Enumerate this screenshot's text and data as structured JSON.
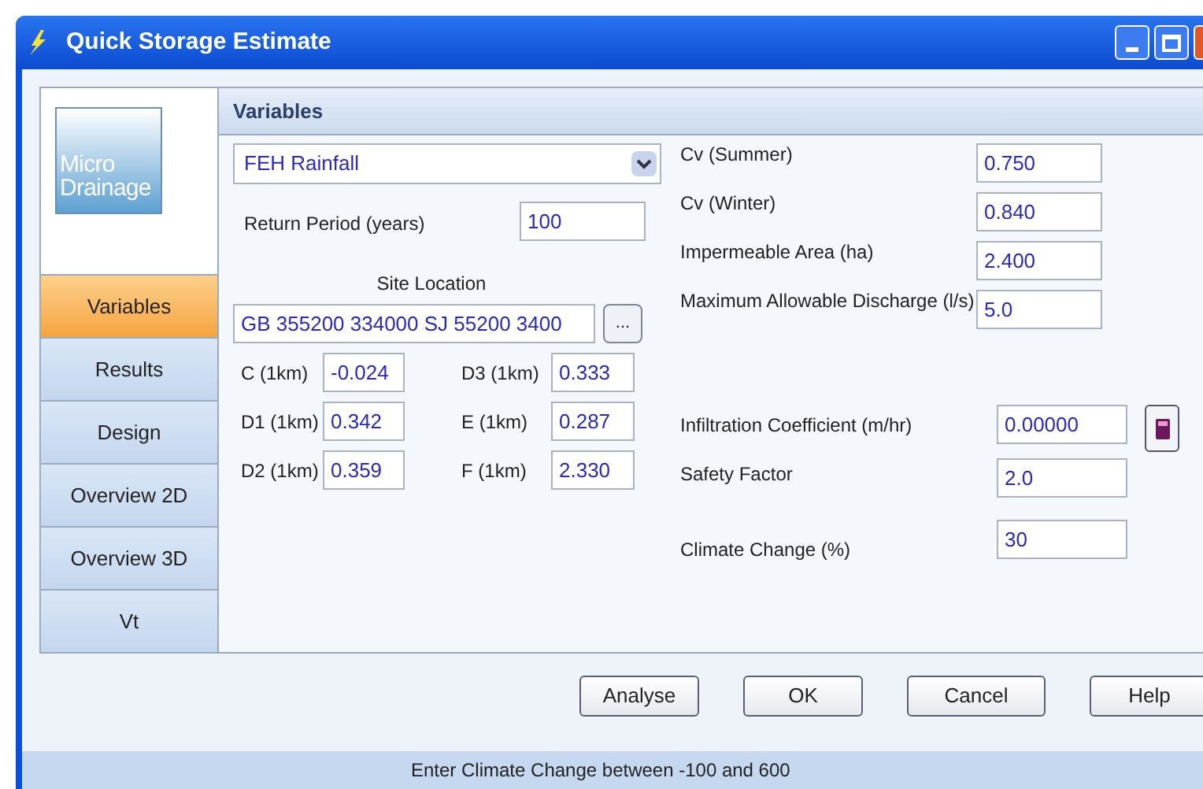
{
  "window": {
    "title": "Quick Storage Estimate"
  },
  "logo": {
    "line1": "Micro",
    "line2": "Drainage"
  },
  "sidebar": {
    "items": [
      {
        "label": "Variables",
        "selected": true
      },
      {
        "label": "Results",
        "selected": false
      },
      {
        "label": "Design",
        "selected": false
      },
      {
        "label": "Overview 2D",
        "selected": false
      },
      {
        "label": "Overview 3D",
        "selected": false
      },
      {
        "label": "Vt",
        "selected": false
      }
    ]
  },
  "panel": {
    "header": "Variables",
    "rainfall_dropdown": {
      "value": "FEH Rainfall"
    },
    "return_period": {
      "label": "Return Period (years)",
      "value": "100"
    },
    "site_location": {
      "label": "Site Location",
      "value": "GB 355200 334000 SJ 55200 3400",
      "browse": "..."
    },
    "fen_grid": [
      {
        "label": "C (1km)",
        "value": "-0.024"
      },
      {
        "label": "D3 (1km)",
        "value": "0.333"
      },
      {
        "label": "D1 (1km)",
        "value": "0.342"
      },
      {
        "label": "E (1km)",
        "value": "0.287"
      },
      {
        "label": "D2 (1km)",
        "value": "0.359"
      },
      {
        "label": "F (1km)",
        "value": "2.330"
      }
    ],
    "upper_fields": [
      {
        "label": "Cv (Summer)",
        "value": "0.750"
      },
      {
        "label": "Cv (Winter)",
        "value": "0.840"
      },
      {
        "label": "Impermeable Area (ha)",
        "value": "2.400"
      },
      {
        "label": "Maximum Allowable Discharge (l/s)",
        "value": "5.0"
      }
    ],
    "lower_fields": [
      {
        "label": "Infiltration Coefficient (m/hr)",
        "value": "0.00000"
      },
      {
        "label": "Safety Factor",
        "value": "2.0"
      },
      {
        "label": "Climate Change (%)",
        "value": "30"
      }
    ]
  },
  "buttons": [
    "Analyse",
    "OK",
    "Cancel",
    "Help"
  ],
  "status_bar": "Enter Climate Change between -100 and 600"
}
